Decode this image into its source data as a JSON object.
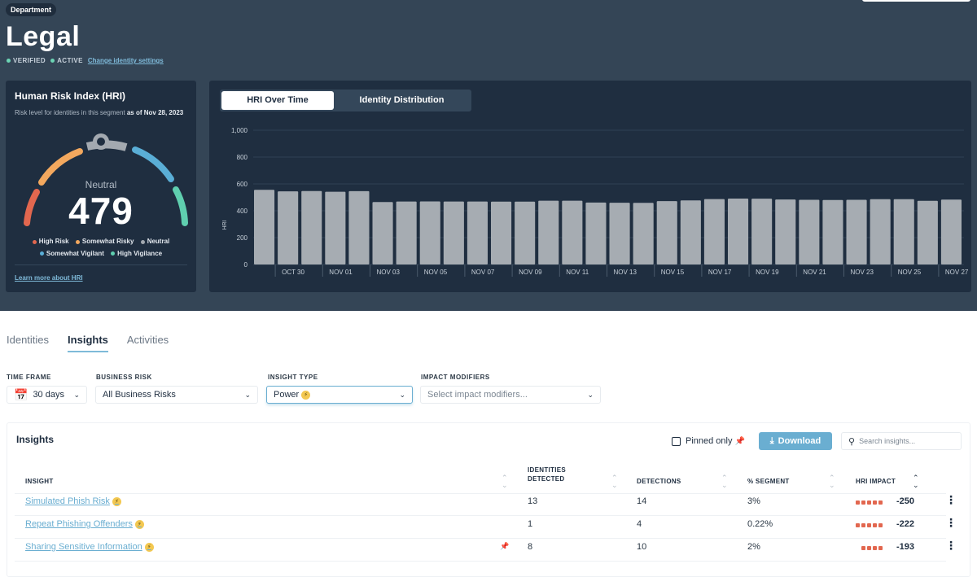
{
  "header": {
    "badge": "Department",
    "title": "Legal",
    "statuses": [
      "VERIFIED",
      "ACTIVE"
    ],
    "settings_link": "Change identity settings"
  },
  "hri": {
    "title": "Human Risk Index (HRI)",
    "subtitle": "Risk level for identities in this segment ",
    "subtitle_date": "as of Nov 28, 2023",
    "level": "Neutral",
    "value": "479",
    "gauge_fraction": 0.479,
    "legend": [
      {
        "label": "High Risk",
        "color": "#e2674f"
      },
      {
        "label": "Somewhat Risky",
        "color": "#f3a85e"
      },
      {
        "label": "Neutral",
        "color": "#a3a9b0"
      },
      {
        "label": "Somewhat Vigilant",
        "color": "#5aaed6"
      },
      {
        "label": "High Vigilance",
        "color": "#5fcfaf"
      }
    ],
    "learn_more": "Learn more about HRI"
  },
  "chart_tabs": {
    "active": "HRI Over Time",
    "inactive": "Identity Distribution"
  },
  "chart_data": {
    "type": "bar",
    "title": "HRI Over Time",
    "xlabel": "",
    "ylabel": "HRI",
    "ylim": [
      0,
      1000
    ],
    "yticks": [
      "0",
      "200",
      "400",
      "600",
      "800",
      "1,000"
    ],
    "grid": true,
    "bar_color": "#a6acb2",
    "categories": [
      "Oct 29",
      "Oct 30",
      "Oct 31",
      "Nov 01",
      "Nov 02",
      "Nov 03",
      "Nov 04",
      "Nov 05",
      "Nov 06",
      "Nov 07",
      "Nov 08",
      "Nov 09",
      "Nov 10",
      "Nov 11",
      "Nov 12",
      "Nov 13",
      "Nov 14",
      "Nov 15",
      "Nov 16",
      "Nov 17",
      "Nov 18",
      "Nov 19",
      "Nov 20",
      "Nov 21",
      "Nov 22",
      "Nov 23",
      "Nov 24",
      "Nov 25",
      "Nov 26",
      "Nov 27"
    ],
    "xtick_labels": [
      "OCT 30",
      "NOV 01",
      "NOV 03",
      "NOV 05",
      "NOV 07",
      "NOV 09",
      "NOV 11",
      "NOV 13",
      "NOV 15",
      "NOV 17",
      "NOV 19",
      "NOV 21",
      "NOV 23",
      "NOV 25",
      "NOV 27"
    ],
    "values": [
      556,
      545,
      547,
      542,
      546,
      465,
      469,
      470,
      469,
      469,
      468,
      468,
      475,
      475,
      461,
      460,
      459,
      472,
      477,
      487,
      491,
      490,
      484,
      482,
      480,
      482,
      486,
      486,
      474,
      483
    ]
  },
  "tabs": [
    {
      "label": "Identities",
      "active": false
    },
    {
      "label": "Insights",
      "active": true
    },
    {
      "label": "Activities",
      "active": false
    }
  ],
  "filters": {
    "time_frame": {
      "label": "TIME FRAME",
      "value": "30 days"
    },
    "business_risk": {
      "label": "BUSINESS RISK",
      "value": "All Business Risks"
    },
    "insight_type": {
      "label": "INSIGHT TYPE",
      "value": "Power"
    },
    "impact_modifiers": {
      "label": "IMPACT MODIFIERS",
      "placeholder": "Select impact modifiers..."
    }
  },
  "insights": {
    "title": "Insights",
    "pinned_only": "Pinned only",
    "download": "Download",
    "search_placeholder": "Search insights...",
    "columns": [
      "INSIGHT",
      "IDENTITIES",
      "DETECTED",
      "DETECTIONS",
      "% SEGMENT",
      "HRI IMPACT"
    ],
    "rows": [
      {
        "name": "Simulated Phish Risk",
        "pinned": false,
        "identities": "13",
        "detections": "14",
        "segment": "3%",
        "impact_level": 5,
        "impact": "-250"
      },
      {
        "name": "Repeat Phishing Offenders",
        "pinned": false,
        "identities": "1",
        "detections": "4",
        "segment": "0.22%",
        "impact_level": 5,
        "impact": "-222"
      },
      {
        "name": "Sharing Sensitive Information",
        "pinned": true,
        "identities": "8",
        "detections": "10",
        "segment": "2%",
        "impact_level": 4,
        "impact": "-193"
      }
    ]
  }
}
